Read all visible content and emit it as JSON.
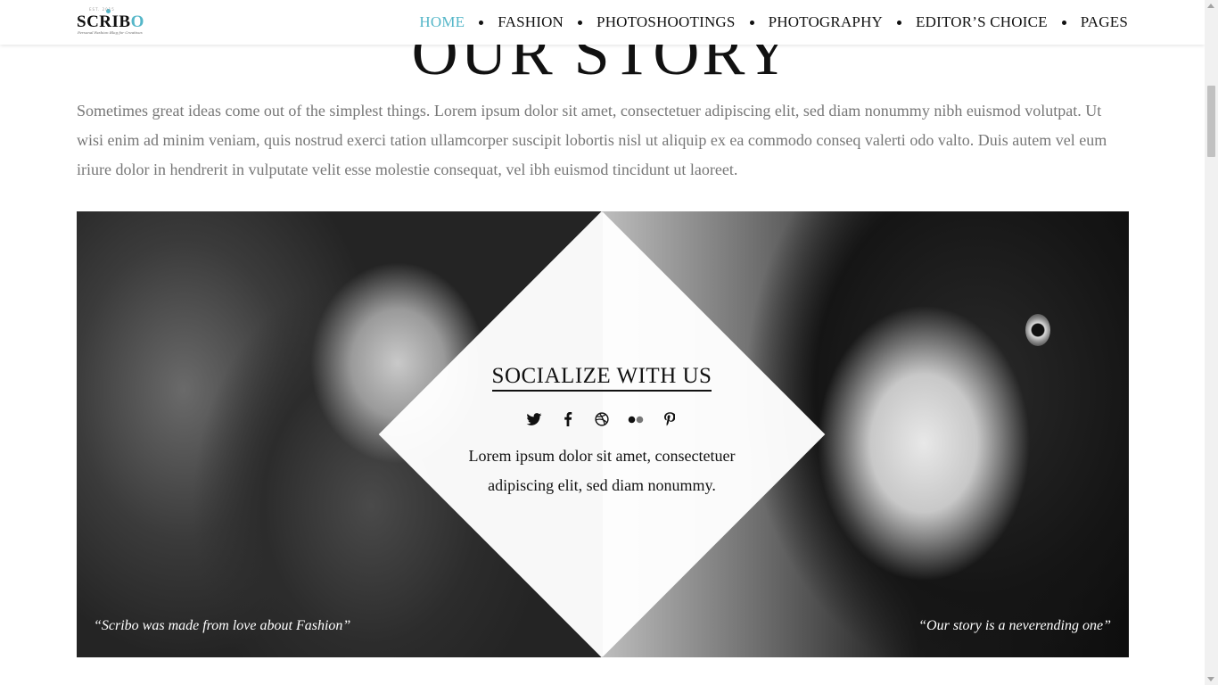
{
  "logo": {
    "top_text": "EST. 2015",
    "wordmark_main": "SCRIB",
    "wordmark_accent": "O",
    "tagline": "Personal Fashion Blog for Creatives"
  },
  "menu": {
    "items": [
      {
        "label": "HOME",
        "active": true
      },
      {
        "label": "FASHION"
      },
      {
        "label": "PHOTOSHOOTINGS"
      },
      {
        "label": "PHOTOGRAPHY"
      },
      {
        "label": "EDITOR’S CHOICE"
      },
      {
        "label": "PAGES"
      }
    ]
  },
  "story": {
    "title": "OUR STORY",
    "body": "Sometimes great ideas come out of the simplest things. Lorem ipsum dolor sit amet, consectetuer adipiscing elit, sed diam nonummy nibh euismod volutpat. Ut wisi enim ad minim veniam, quis nostrud exerci tation ullamcorper suscipit lobortis nisl ut aliquip ex ea commodo conseq valerti odo valto. Duis autem vel eum iriure dolor in hendrerit in vulputate velit esse molestie consequat, vel ibh euismod tincidunt ut laoreet."
  },
  "social": {
    "title": "SOCIALIZE WITH US",
    "icons": [
      "twitter-icon",
      "facebook-icon",
      "dribbble-icon",
      "flickr-icon",
      "pinterest-icon"
    ],
    "text": "Lorem ipsum dolor sit amet, consectetuer adipiscing elit, sed diam nonummy."
  },
  "quotes": {
    "left": "“Scribo was made from love about Fashion”",
    "right": "“Our story is a neverending one”"
  },
  "colors": {
    "accent": "#54b6c8",
    "text": "#111111",
    "muted": "#777777"
  }
}
